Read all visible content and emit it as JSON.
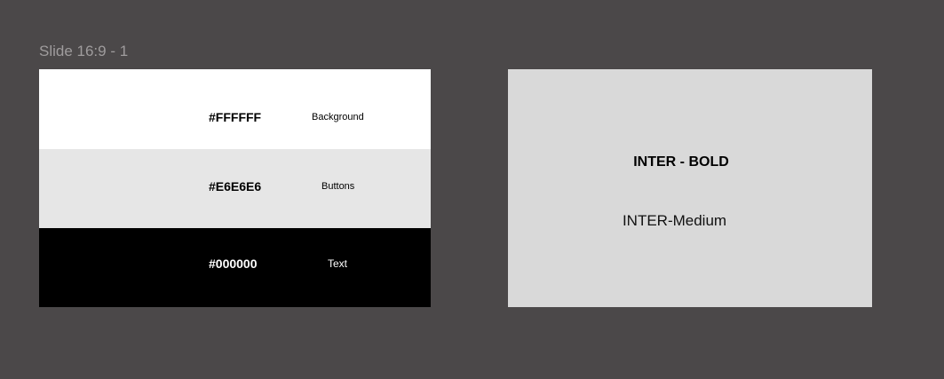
{
  "canvas": {
    "background": "#4b4849",
    "frame_label": "Slide 16:9 - 1"
  },
  "palette": {
    "swatches": [
      {
        "hex": "#FFFFFF",
        "role": "Background",
        "fill": "#ffffff",
        "text_color": "#000000"
      },
      {
        "hex": "#E6E6E6",
        "role": "Buttons",
        "fill": "#e6e6e6",
        "text_color": "#000000"
      },
      {
        "hex": "#000000",
        "role": "Text",
        "fill": "#000000",
        "text_color": "#ffffff"
      }
    ]
  },
  "typography": {
    "background": "#d9d9d9",
    "bold_label": "INTER - BOLD",
    "medium_label": "INTER-Medium"
  }
}
